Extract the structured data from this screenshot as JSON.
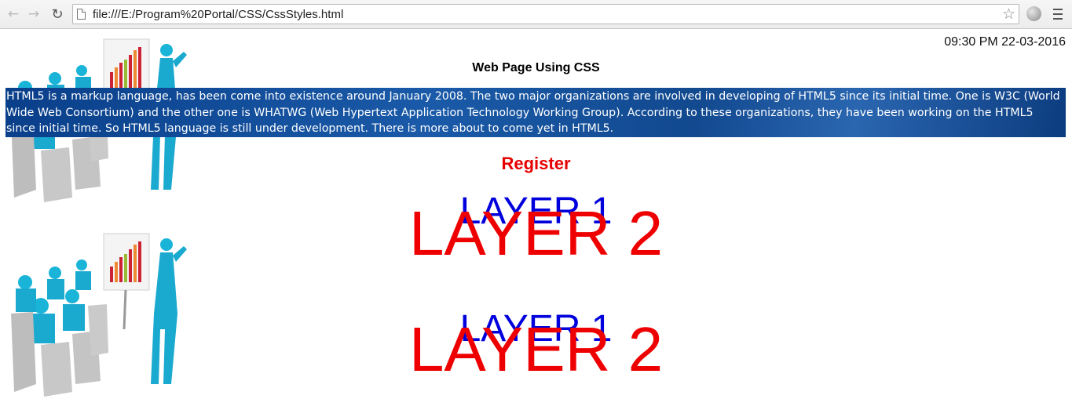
{
  "browser": {
    "url": "file:///E:/Program%20Portal/CSS/CssStyles.html",
    "back_icon": "back-arrow-icon",
    "forward_icon": "forward-arrow-icon",
    "reload_icon": "reload-icon",
    "bookmark_icon": "star-icon",
    "menu_icon": "hamburger-menu-icon"
  },
  "page": {
    "datetime": "09:30 PM 22-03-2016",
    "title": "Web Page Using CSS",
    "paragraph": "HTML5 is a markup language, has been come into existence around January 2008. The two major organizations are involved in developing of HTML5 since its initial time. One is W3C (World Wide Web Consortium) and the other one is WHATWG (Web Hypertext Application Technology Working Group). According to these organizations, they have been working on the HTML5 since initial time. So HTML5 language is still under development. There is more about to come yet in HTML5.",
    "register": "Register",
    "layer_groups": [
      {
        "layer1": "LAYER 1",
        "layer2": "LAYER 2"
      },
      {
        "layer1": "LAYER 1",
        "layer2": "LAYER 2"
      }
    ]
  },
  "colors": {
    "paragraph_bg": "#12498f",
    "register": "#e60000",
    "layer1": "#0000dd",
    "layer2": "#ee0000"
  }
}
